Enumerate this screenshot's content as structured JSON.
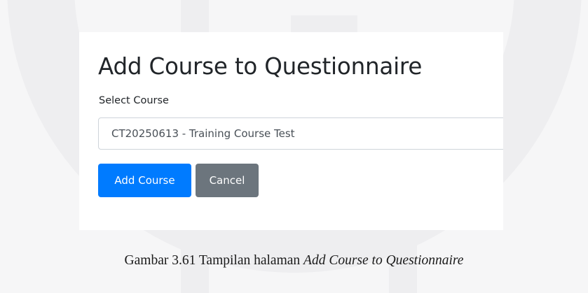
{
  "page": {
    "title": "Add Course to Questionnaire"
  },
  "form": {
    "select_label": "Select Course",
    "selected_course": "CT20250613 - Training Course Test",
    "add_button_label": "Add Course",
    "cancel_button_label": "Cancel"
  },
  "caption": {
    "prefix": "Gambar 3.61 Tampilan halaman ",
    "emphasis": "Add Course to Questionnaire"
  },
  "colors": {
    "primary": "#007bff",
    "secondary": "#6c757d",
    "panel_background": "#ffffff",
    "page_background": "#f6f6f7"
  }
}
